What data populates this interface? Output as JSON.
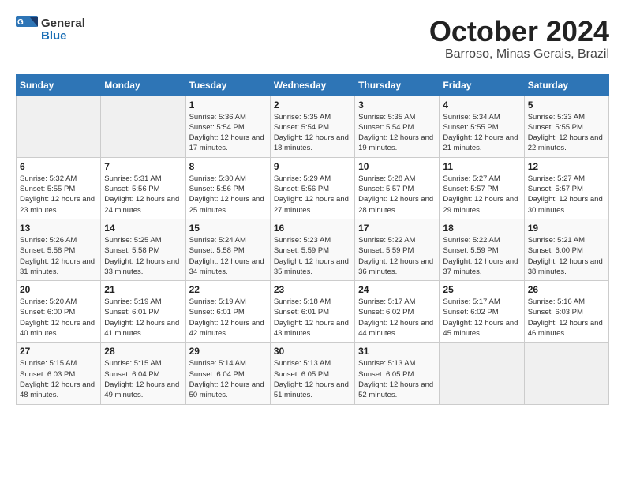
{
  "header": {
    "logo_general": "General",
    "logo_blue": "Blue",
    "title": "October 2024",
    "location": "Barroso, Minas Gerais, Brazil"
  },
  "weekdays": [
    "Sunday",
    "Monday",
    "Tuesday",
    "Wednesday",
    "Thursday",
    "Friday",
    "Saturday"
  ],
  "weeks": [
    [
      {
        "day": "",
        "empty": true
      },
      {
        "day": "",
        "empty": true
      },
      {
        "day": "1",
        "sunrise": "5:36 AM",
        "sunset": "5:54 PM",
        "daylight": "12 hours and 17 minutes."
      },
      {
        "day": "2",
        "sunrise": "5:35 AM",
        "sunset": "5:54 PM",
        "daylight": "12 hours and 18 minutes."
      },
      {
        "day": "3",
        "sunrise": "5:35 AM",
        "sunset": "5:54 PM",
        "daylight": "12 hours and 19 minutes."
      },
      {
        "day": "4",
        "sunrise": "5:34 AM",
        "sunset": "5:55 PM",
        "daylight": "12 hours and 21 minutes."
      },
      {
        "day": "5",
        "sunrise": "5:33 AM",
        "sunset": "5:55 PM",
        "daylight": "12 hours and 22 minutes."
      }
    ],
    [
      {
        "day": "6",
        "sunrise": "5:32 AM",
        "sunset": "5:55 PM",
        "daylight": "12 hours and 23 minutes."
      },
      {
        "day": "7",
        "sunrise": "5:31 AM",
        "sunset": "5:56 PM",
        "daylight": "12 hours and 24 minutes."
      },
      {
        "day": "8",
        "sunrise": "5:30 AM",
        "sunset": "5:56 PM",
        "daylight": "12 hours and 25 minutes."
      },
      {
        "day": "9",
        "sunrise": "5:29 AM",
        "sunset": "5:56 PM",
        "daylight": "12 hours and 27 minutes."
      },
      {
        "day": "10",
        "sunrise": "5:28 AM",
        "sunset": "5:57 PM",
        "daylight": "12 hours and 28 minutes."
      },
      {
        "day": "11",
        "sunrise": "5:27 AM",
        "sunset": "5:57 PM",
        "daylight": "12 hours and 29 minutes."
      },
      {
        "day": "12",
        "sunrise": "5:27 AM",
        "sunset": "5:57 PM",
        "daylight": "12 hours and 30 minutes."
      }
    ],
    [
      {
        "day": "13",
        "sunrise": "5:26 AM",
        "sunset": "5:58 PM",
        "daylight": "12 hours and 31 minutes."
      },
      {
        "day": "14",
        "sunrise": "5:25 AM",
        "sunset": "5:58 PM",
        "daylight": "12 hours and 33 minutes."
      },
      {
        "day": "15",
        "sunrise": "5:24 AM",
        "sunset": "5:58 PM",
        "daylight": "12 hours and 34 minutes."
      },
      {
        "day": "16",
        "sunrise": "5:23 AM",
        "sunset": "5:59 PM",
        "daylight": "12 hours and 35 minutes."
      },
      {
        "day": "17",
        "sunrise": "5:22 AM",
        "sunset": "5:59 PM",
        "daylight": "12 hours and 36 minutes."
      },
      {
        "day": "18",
        "sunrise": "5:22 AM",
        "sunset": "5:59 PM",
        "daylight": "12 hours and 37 minutes."
      },
      {
        "day": "19",
        "sunrise": "5:21 AM",
        "sunset": "6:00 PM",
        "daylight": "12 hours and 38 minutes."
      }
    ],
    [
      {
        "day": "20",
        "sunrise": "5:20 AM",
        "sunset": "6:00 PM",
        "daylight": "12 hours and 40 minutes."
      },
      {
        "day": "21",
        "sunrise": "5:19 AM",
        "sunset": "6:01 PM",
        "daylight": "12 hours and 41 minutes."
      },
      {
        "day": "22",
        "sunrise": "5:19 AM",
        "sunset": "6:01 PM",
        "daylight": "12 hours and 42 minutes."
      },
      {
        "day": "23",
        "sunrise": "5:18 AM",
        "sunset": "6:01 PM",
        "daylight": "12 hours and 43 minutes."
      },
      {
        "day": "24",
        "sunrise": "5:17 AM",
        "sunset": "6:02 PM",
        "daylight": "12 hours and 44 minutes."
      },
      {
        "day": "25",
        "sunrise": "5:17 AM",
        "sunset": "6:02 PM",
        "daylight": "12 hours and 45 minutes."
      },
      {
        "day": "26",
        "sunrise": "5:16 AM",
        "sunset": "6:03 PM",
        "daylight": "12 hours and 46 minutes."
      }
    ],
    [
      {
        "day": "27",
        "sunrise": "5:15 AM",
        "sunset": "6:03 PM",
        "daylight": "12 hours and 48 minutes."
      },
      {
        "day": "28",
        "sunrise": "5:15 AM",
        "sunset": "6:04 PM",
        "daylight": "12 hours and 49 minutes."
      },
      {
        "day": "29",
        "sunrise": "5:14 AM",
        "sunset": "6:04 PM",
        "daylight": "12 hours and 50 minutes."
      },
      {
        "day": "30",
        "sunrise": "5:13 AM",
        "sunset": "6:05 PM",
        "daylight": "12 hours and 51 minutes."
      },
      {
        "day": "31",
        "sunrise": "5:13 AM",
        "sunset": "6:05 PM",
        "daylight": "12 hours and 52 minutes."
      },
      {
        "day": "",
        "empty": true
      },
      {
        "day": "",
        "empty": true
      }
    ]
  ]
}
